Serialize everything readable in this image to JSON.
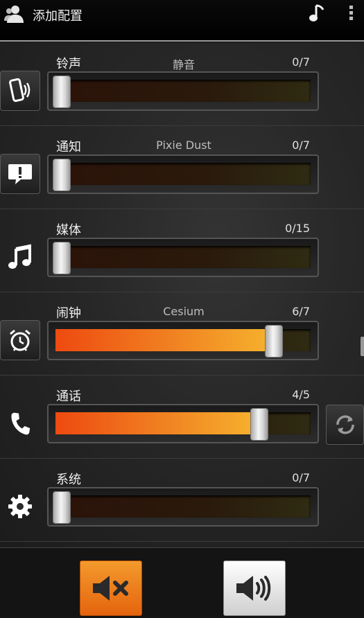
{
  "header": {
    "title": "添加配置",
    "icons": [
      "people-icon",
      "music-note-icon",
      "overflow-menu-icon"
    ]
  },
  "rows": [
    {
      "label": "铃声",
      "sub": "静音",
      "count": "0/7",
      "level": 0,
      "icon": "phone-vibrate-icon"
    },
    {
      "label": "通知",
      "sub": "Pixie Dust",
      "count": "0/7",
      "level": 0,
      "icon": "notification-icon"
    },
    {
      "label": "媒体",
      "sub": "",
      "count": "0/15",
      "level": 0,
      "icon": "music-icon"
    },
    {
      "label": "闹钟",
      "sub": "Cesium",
      "count": "6/7",
      "level": 0.857,
      "icon": "alarm-clock-icon"
    },
    {
      "label": "通话",
      "sub": "",
      "count": "4/5",
      "level": 0.8,
      "icon": "phone-icon"
    },
    {
      "label": "系统",
      "sub": "",
      "count": "0/7",
      "level": 0,
      "icon": "gear-icon"
    }
  ],
  "bottom": {
    "mute_icon": "volume-mute-icon",
    "sound_icon": "volume-up-icon"
  },
  "colors": {
    "accent": "#f07e20",
    "fill_start": "#ee4a10",
    "fill_end": "#f6b32e"
  }
}
